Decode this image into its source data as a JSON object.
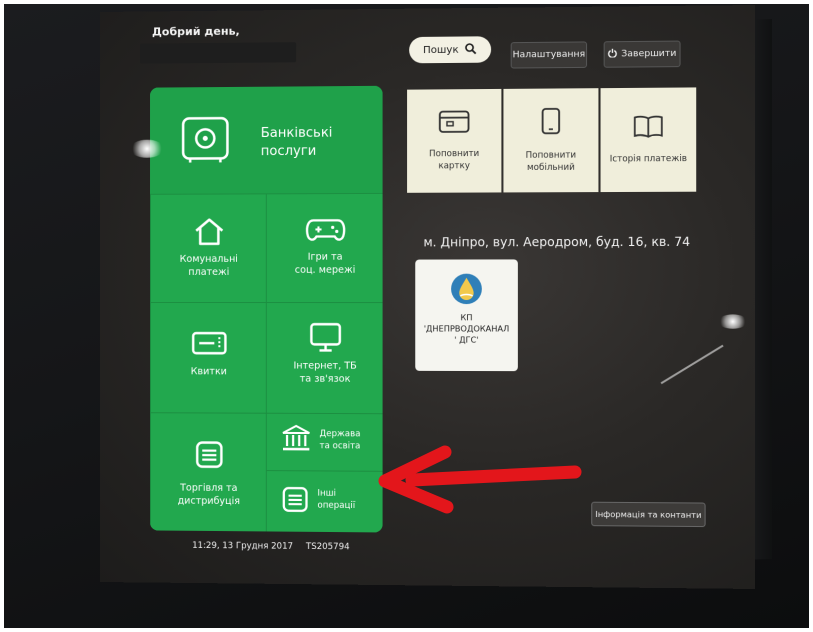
{
  "header": {
    "greeting": "Добрий день,",
    "search_label": "Пошук",
    "settings_label": "Налаштування",
    "finish_label": "Завершити"
  },
  "menu": {
    "bank_services": "Банківські послуги",
    "utilities_line1": "Комунальні",
    "utilities_line2": "платежі",
    "games_line1": "Ігри та",
    "games_line2": "соц. мережі",
    "tickets": "Квитки",
    "internet_line1": "Інтернет, ТБ",
    "internet_line2": "та зв'язок",
    "state_line1": "Держава",
    "state_line2": "та освіта",
    "trade_line1": "Торгівля та",
    "trade_line2": "дистрибуція",
    "other_line1": "Інші",
    "other_line2": "операції"
  },
  "quick": {
    "topup_card_line1": "Поповнити",
    "topup_card_line2": "картку",
    "topup_mobile_line1": "Поповнити",
    "topup_mobile_line2": "мобільний",
    "history": "Історія платежів"
  },
  "address": "м. Дніпро, вул. Аеродром, буд. 16, кв. 74",
  "provider": {
    "line1": "КП",
    "line2": "'ДНЕПРВОДОКАНАЛ",
    "line3": "' ДГС'"
  },
  "footer": {
    "info_label": "Інформація та контанти",
    "datetime": "11:29,  13 Грудня 2017",
    "terminal_id": "TS205794"
  },
  "colors": {
    "green": "#1fa14a",
    "tile_light": "#f0eedb",
    "arrow": "#e3161b"
  },
  "icons": [
    "safe-icon",
    "house-icon",
    "gamepad-icon",
    "ticket-icon",
    "monitor-icon",
    "bank-building-icon",
    "list-icon",
    "card-icon",
    "phone-icon",
    "book-icon",
    "search-icon",
    "power-icon",
    "water-drop-logo"
  ]
}
